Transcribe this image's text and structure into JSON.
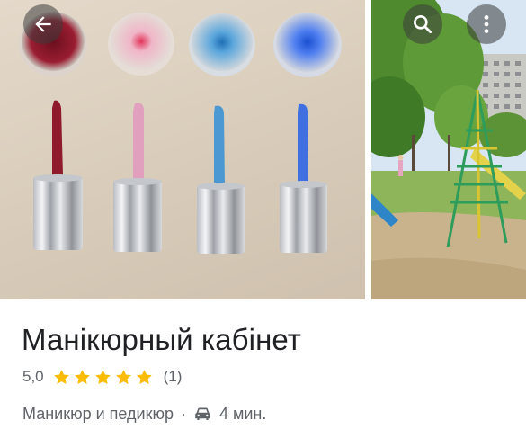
{
  "place": {
    "title": "Манікюрный кабінет",
    "rating": "5,0",
    "stars": 5,
    "reviews": "(1)",
    "category": "Маникюр и педикюр",
    "separator": "·",
    "travel_time": "4 мин."
  },
  "colors": {
    "star": "#fbbc04",
    "polish": [
      "#8e1a2c",
      "#e8a6bf",
      "#4b98d2",
      "#3f6fe0"
    ]
  },
  "icons": {
    "back": "arrow-left-icon",
    "search": "search-icon",
    "more": "more-vert-icon",
    "travel": "car-icon"
  }
}
